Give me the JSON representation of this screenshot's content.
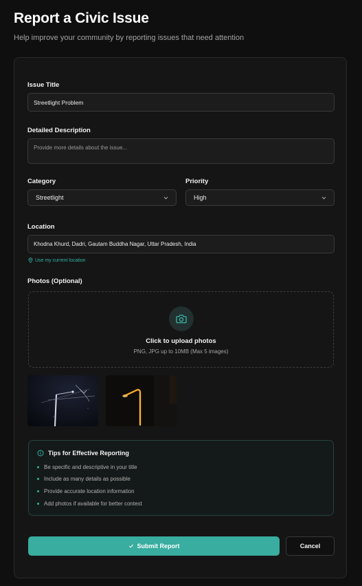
{
  "header": {
    "title": "Report a Civic Issue",
    "subtitle": "Help improve your community by reporting issues that need attention"
  },
  "form": {
    "issue_title": {
      "label": "Issue Title",
      "value": "Streetlight Problem"
    },
    "description": {
      "label": "Detailed Description",
      "placeholder": "Provide more details about the issue..."
    },
    "category": {
      "label": "Category",
      "value": "Streetlight"
    },
    "priority": {
      "label": "Priority",
      "value": "High"
    },
    "location": {
      "label": "Location",
      "value": "Khodna Khurd, Dadri, Gautam Buddha Nagar, Uttar Pradesh, India",
      "use_current_label": "Use my current location"
    },
    "photos": {
      "label": "Photos (Optional)",
      "upload_title": "Click to upload photos",
      "upload_hint": "PNG, JPG up to 10MB (Max 5 images)",
      "thumbnails": [
        "night-streetlight-photo",
        "lit-streetlamp-photo"
      ]
    },
    "tips": {
      "title": "Tips for Effective Reporting",
      "items": [
        "Be specific and descriptive in your title",
        "Include as many details as possible",
        "Provide accurate location information",
        "Add photos if available for better context"
      ]
    },
    "actions": {
      "submit_label": "Submit Report",
      "cancel_label": "Cancel"
    }
  },
  "colors": {
    "accent": "#38ada0",
    "background": "#0f0f0f",
    "card": "#151515"
  },
  "icons": [
    "camera-icon",
    "map-pin-icon",
    "chevron-down-icon",
    "info-icon",
    "check-icon"
  ]
}
